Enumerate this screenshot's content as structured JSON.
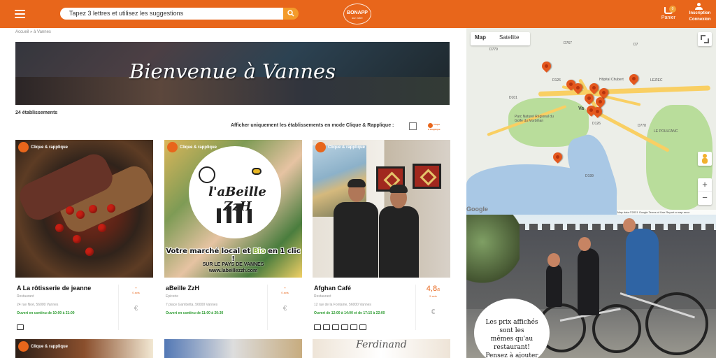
{
  "header": {
    "search_placeholder": "Tapez 3 lettres et utilisez les suggestions",
    "brand": "BONAPP",
    "brand_tagline": "sur votre",
    "cart_label": "Panier",
    "cart_count": "0",
    "inscription_label": "Inscription",
    "connexion_label": "Connexion",
    "brand_color": "#e8661b"
  },
  "page": {
    "breadcrumb": "Accueil » à Vannes",
    "hero_title": "Bienvenue à Vannes",
    "count": "24 établissements",
    "filter_label": "Afficher uniquement les établissements en mode Clique & Rapplique :",
    "filter_logo_text": "Clique & Rapplique",
    "badge_text": "Clique & rapplique"
  },
  "restaurants": [
    {
      "name": "A La rôtisserie de jeanne",
      "category": "Restaurant",
      "address": "24 rue Noé, 56000 Vannes",
      "hours": "Ouvert en continu de 10:00 à 21:00",
      "rating": "-",
      "rating_label": "0 avis",
      "price": "€",
      "feature_icons": [
        "takeaway-icon"
      ]
    },
    {
      "name": "aBeille ZzH",
      "category": "Epicerie",
      "address": "7 place Gambetta, 56000 Vannes",
      "hours": "Ouvert en continu de 11:00 à 20:30",
      "rating": "-",
      "rating_label": "0 avis",
      "price": "€",
      "logo_text": "l'aBeille ZzH",
      "slogan_start": "Votre marché local et ",
      "slogan_highlight": "Bio",
      "slogan_end": " en 1 clic !",
      "territory": "SUR LE PAYS DE VANNES",
      "website": "www.labeillezzh.com"
    },
    {
      "name": "Afghan Café",
      "category": "Restaurant",
      "address": "12 rue de la Fontaine, 56000 Vannes",
      "hours": "Ouvert de 12:00 à 14:00 et de 17:15 à 22:00",
      "rating": "4,8",
      "rating_suffix": "/5",
      "rating_label": "5 avis",
      "price": "€",
      "feature_icons": [
        "takeaway-icon",
        "card-icon",
        "delivery-icon",
        "no-gluten-icon",
        "bag-icon",
        "speaker-icon"
      ]
    },
    {
      "name_bottom": "Ferdinand"
    }
  ],
  "map": {
    "map_tab": "Map",
    "satellite_tab": "Satellite",
    "city": "Vannes",
    "city_short": "Va",
    "hospital": "Hôpital Chubert",
    "area1": "LE POULFANC",
    "area2": "LEZIEC",
    "park": "Parc Naturel Régional du Golfe du Morbihan",
    "google": "Google",
    "footer": "Map data ©2021 Google   Terms of Use   Report a map error",
    "zoom_in": "+",
    "zoom_out": "−",
    "road_labels": [
      "D767",
      "D779",
      "D126",
      "D101",
      "D778",
      "D199",
      "D126",
      "D7"
    ]
  },
  "promo": {
    "line1": "Les prix affichés",
    "line2": "sont les",
    "line3": "mêmes qu'au restaurant!",
    "line4": "Pensez à ajouter"
  }
}
